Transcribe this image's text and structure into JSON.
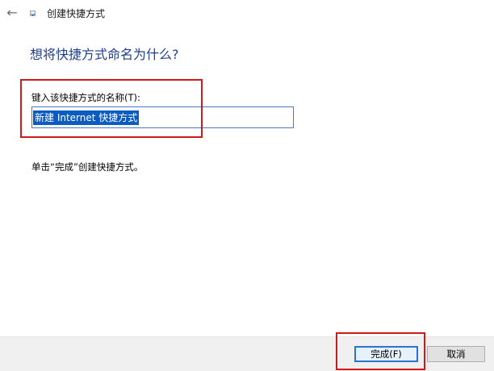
{
  "window": {
    "title": "创建快捷方式",
    "back_icon": "arrow-left-icon",
    "app_icon": "shortcut-icon"
  },
  "content": {
    "heading": "想将快捷方式命名为什么?",
    "name_label": "键入该快捷方式的名称(T):",
    "name_value": "新建 Internet 快捷方式",
    "instruction": "单击“完成”创建快捷方式。"
  },
  "buttons": {
    "finish_label": "完成(F)",
    "cancel_label": "取消"
  },
  "colors": {
    "heading": "#1f3f8f",
    "selection": "#0a5cc2",
    "annotation": "#d01a1a",
    "footer": "#f0f0f0"
  }
}
